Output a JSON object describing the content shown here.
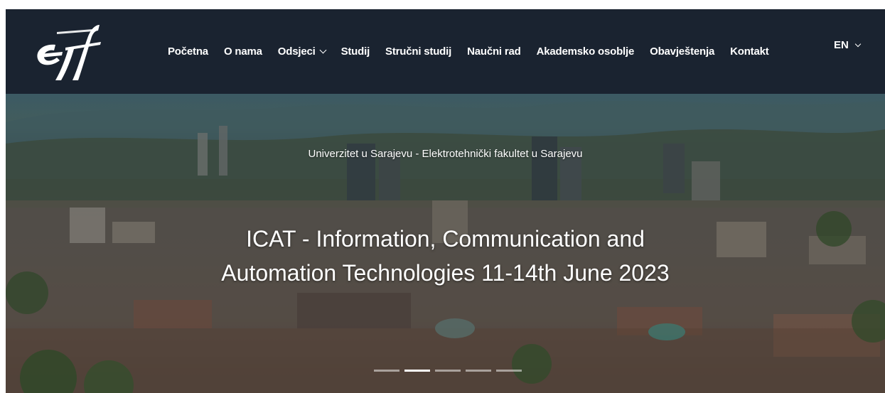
{
  "brand": {
    "logo_icon": "etf-logo-icon",
    "logo_color": "#ffffff"
  },
  "nav": {
    "items": [
      {
        "label": "Početna",
        "has_dropdown": false
      },
      {
        "label": "O nama",
        "has_dropdown": false
      },
      {
        "label": "Odsjeci",
        "has_dropdown": true
      },
      {
        "label": "Studij",
        "has_dropdown": false
      },
      {
        "label": "Stručni studij",
        "has_dropdown": false
      },
      {
        "label": "Naučni rad",
        "has_dropdown": false
      },
      {
        "label": "Akademsko osoblje",
        "has_dropdown": false
      },
      {
        "label": "Obavještenja",
        "has_dropdown": false
      },
      {
        "label": "Kontakt",
        "has_dropdown": false
      }
    ],
    "language": {
      "label": "EN",
      "has_dropdown": true
    }
  },
  "hero": {
    "subtitle": "Univerzitet u Sarajevu - Elektrotehnički fakultet u Sarajevu",
    "title_line1": "ICAT - Information, Communication and",
    "title_line2": "Automation Technologies 11-14th June 2023",
    "slides": {
      "count": 5,
      "active_index": 1
    }
  },
  "colors": {
    "header_bg": "#1a2330",
    "text": "#ffffff"
  }
}
